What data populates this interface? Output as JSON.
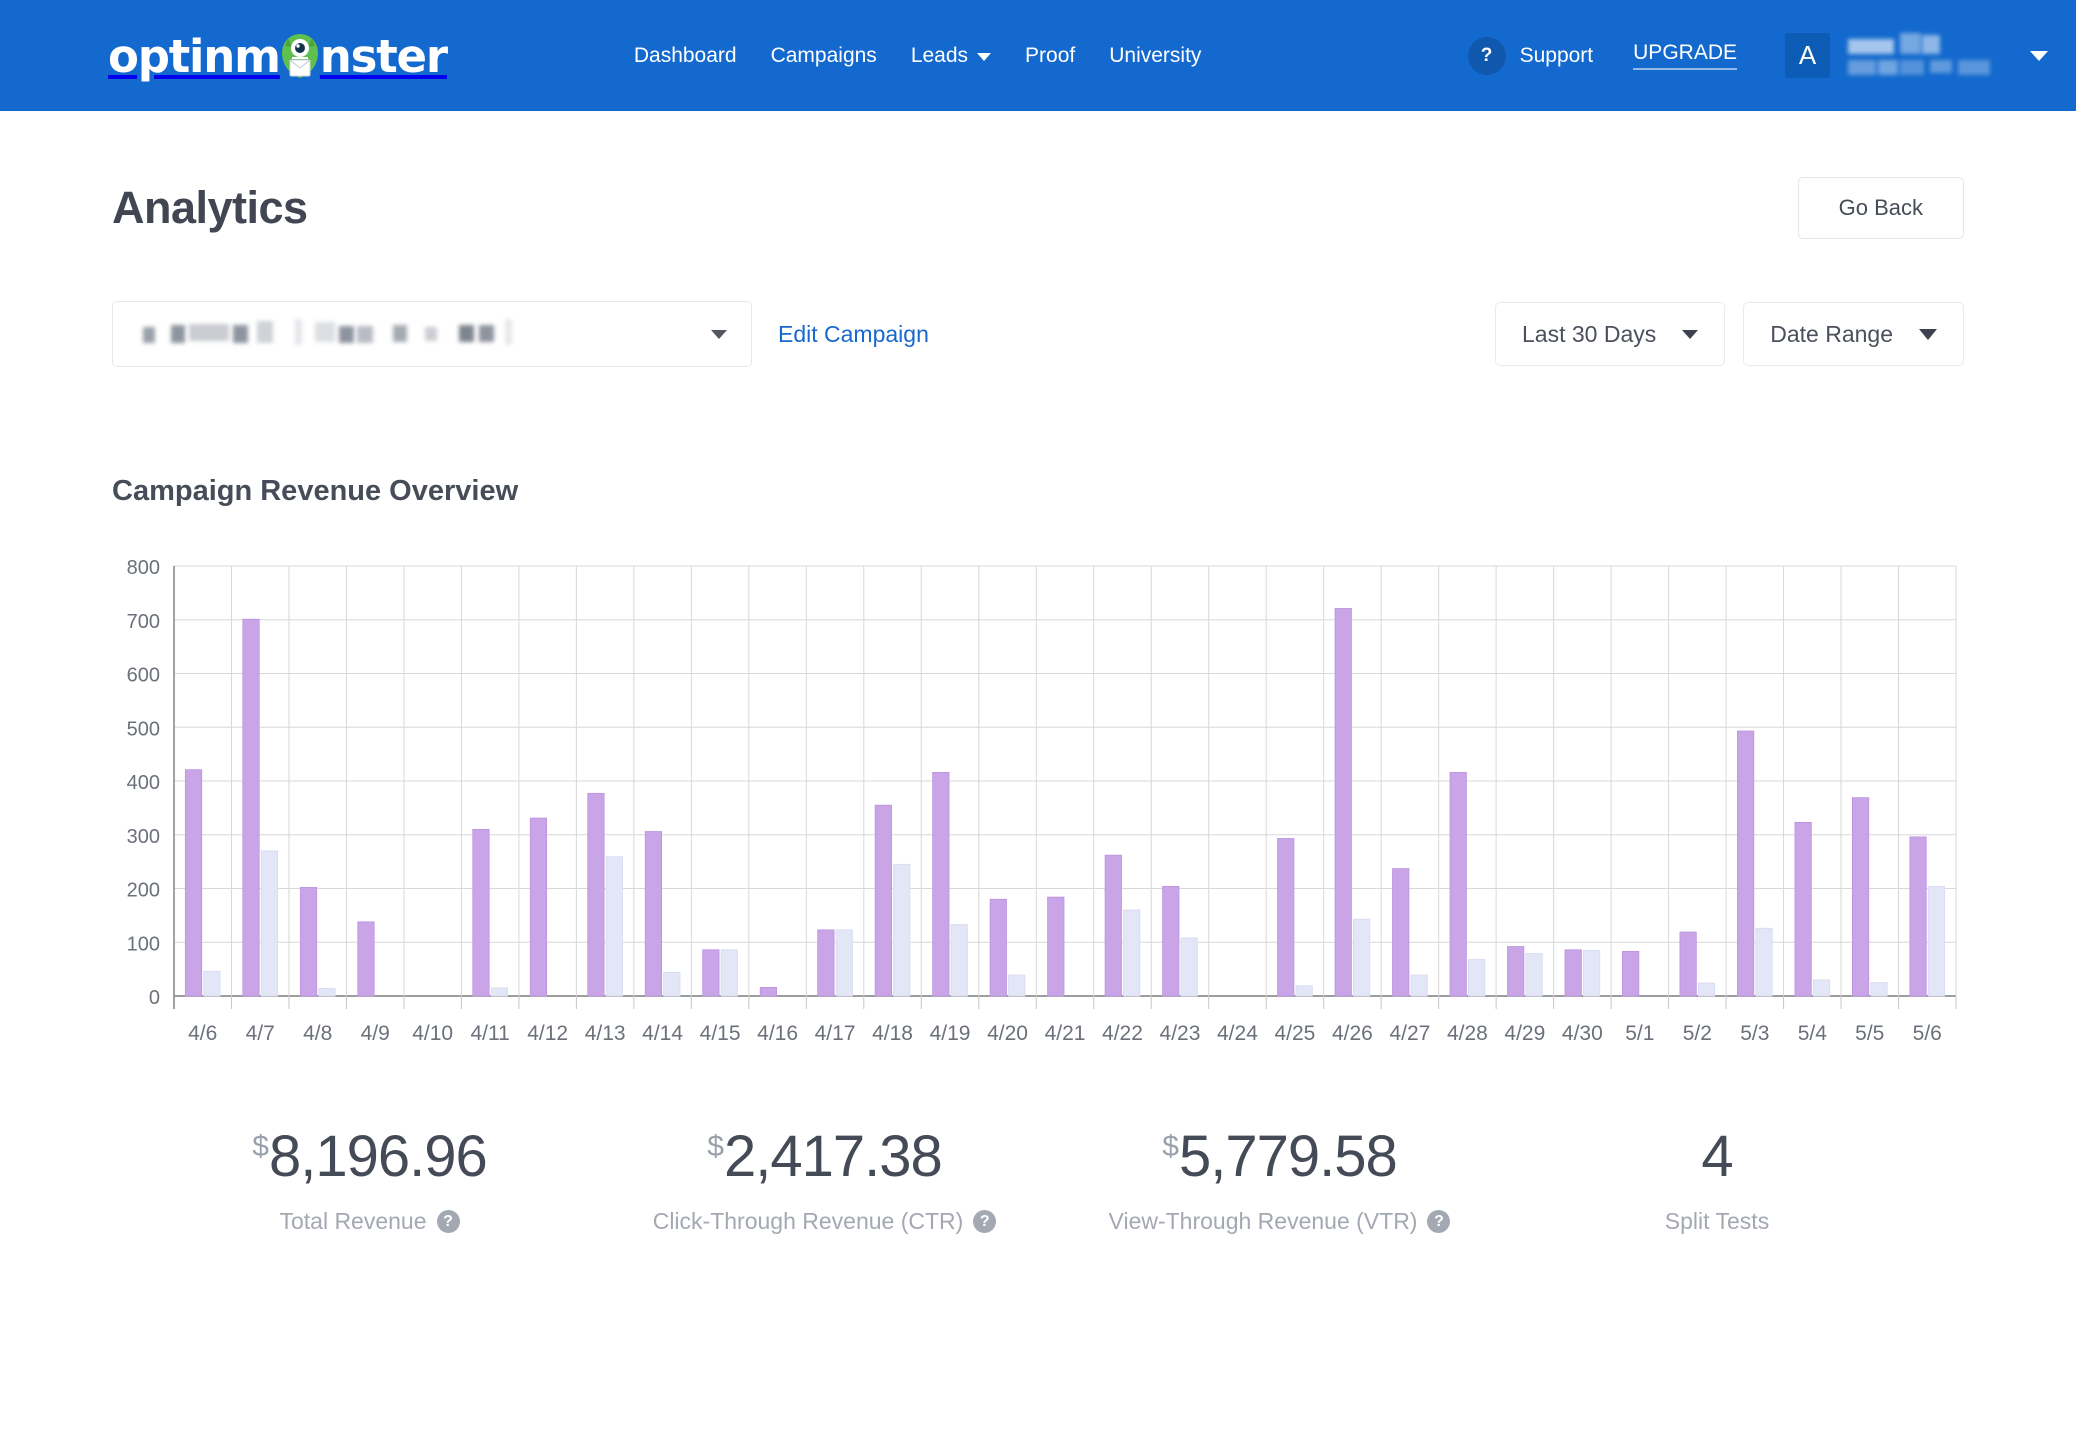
{
  "navbar": {
    "brand": "optinmonster",
    "links": [
      {
        "label": "Dashboard",
        "caret": false
      },
      {
        "label": "Campaigns",
        "caret": false
      },
      {
        "label": "Leads",
        "caret": true
      },
      {
        "label": "Proof",
        "caret": false
      },
      {
        "label": "University",
        "caret": false
      }
    ],
    "help_icon": "?",
    "support_label": "Support",
    "upgrade_label": "UPGRADE",
    "avatar_initial": "A",
    "account_name": "",
    "accent_color": "#1369cd"
  },
  "header": {
    "title": "Analytics",
    "go_back_label": "Go Back"
  },
  "controls": {
    "campaign_value": "",
    "edit_campaign_label": "Edit Campaign",
    "date_preset": "Last 30 Days",
    "date_range_label": "Date Range"
  },
  "chart_data": {
    "type": "bar",
    "title": "Campaign Revenue Overview",
    "xlabel": "",
    "ylabel": "",
    "ylim": [
      0,
      800
    ],
    "yticks": [
      0,
      100,
      200,
      300,
      400,
      500,
      600,
      700,
      800
    ],
    "grid": true,
    "legend": "none",
    "colors": {
      "primary": "#c9a5e8",
      "secondary": "#e3e6f7"
    },
    "categories": [
      "4/6",
      "4/7",
      "4/8",
      "4/9",
      "4/10",
      "4/11",
      "4/12",
      "4/13",
      "4/14",
      "4/15",
      "4/16",
      "4/17",
      "4/18",
      "4/19",
      "4/20",
      "4/21",
      "4/22",
      "4/23",
      "4/24",
      "4/25",
      "4/26",
      "4/27",
      "4/28",
      "4/29",
      "4/30",
      "5/1",
      "5/2",
      "5/3",
      "5/4",
      "5/5",
      "5/6"
    ],
    "series": [
      {
        "name": "View-Through Revenue",
        "color": "#c9a5e8",
        "values": [
          421,
          701,
          202,
          138,
          0,
          310,
          331,
          377,
          306,
          86,
          16,
          123,
          355,
          416,
          180,
          184,
          262,
          204,
          0,
          293,
          721,
          237,
          416,
          92,
          86,
          83,
          119,
          493,
          323,
          369,
          296
        ]
      },
      {
        "name": "Click-Through Revenue",
        "color": "#e3e6f7",
        "values": [
          46,
          270,
          14,
          0,
          0,
          15,
          0,
          259,
          44,
          86,
          0,
          123,
          245,
          133,
          39,
          0,
          160,
          108,
          0,
          19,
          143,
          39,
          68,
          79,
          85,
          0,
          24,
          126,
          30,
          25,
          204
        ]
      }
    ]
  },
  "stats": [
    {
      "currency": "$",
      "value": "8,196.96",
      "label": "Total Revenue",
      "has_help": true
    },
    {
      "currency": "$",
      "value": "2,417.38",
      "label": "Click-Through Revenue (CTR)",
      "has_help": true
    },
    {
      "currency": "$",
      "value": "5,779.58",
      "label": "View-Through Revenue (VTR)",
      "has_help": true
    },
    {
      "currency": "",
      "value": "4",
      "label": "Split Tests",
      "has_help": false
    }
  ]
}
